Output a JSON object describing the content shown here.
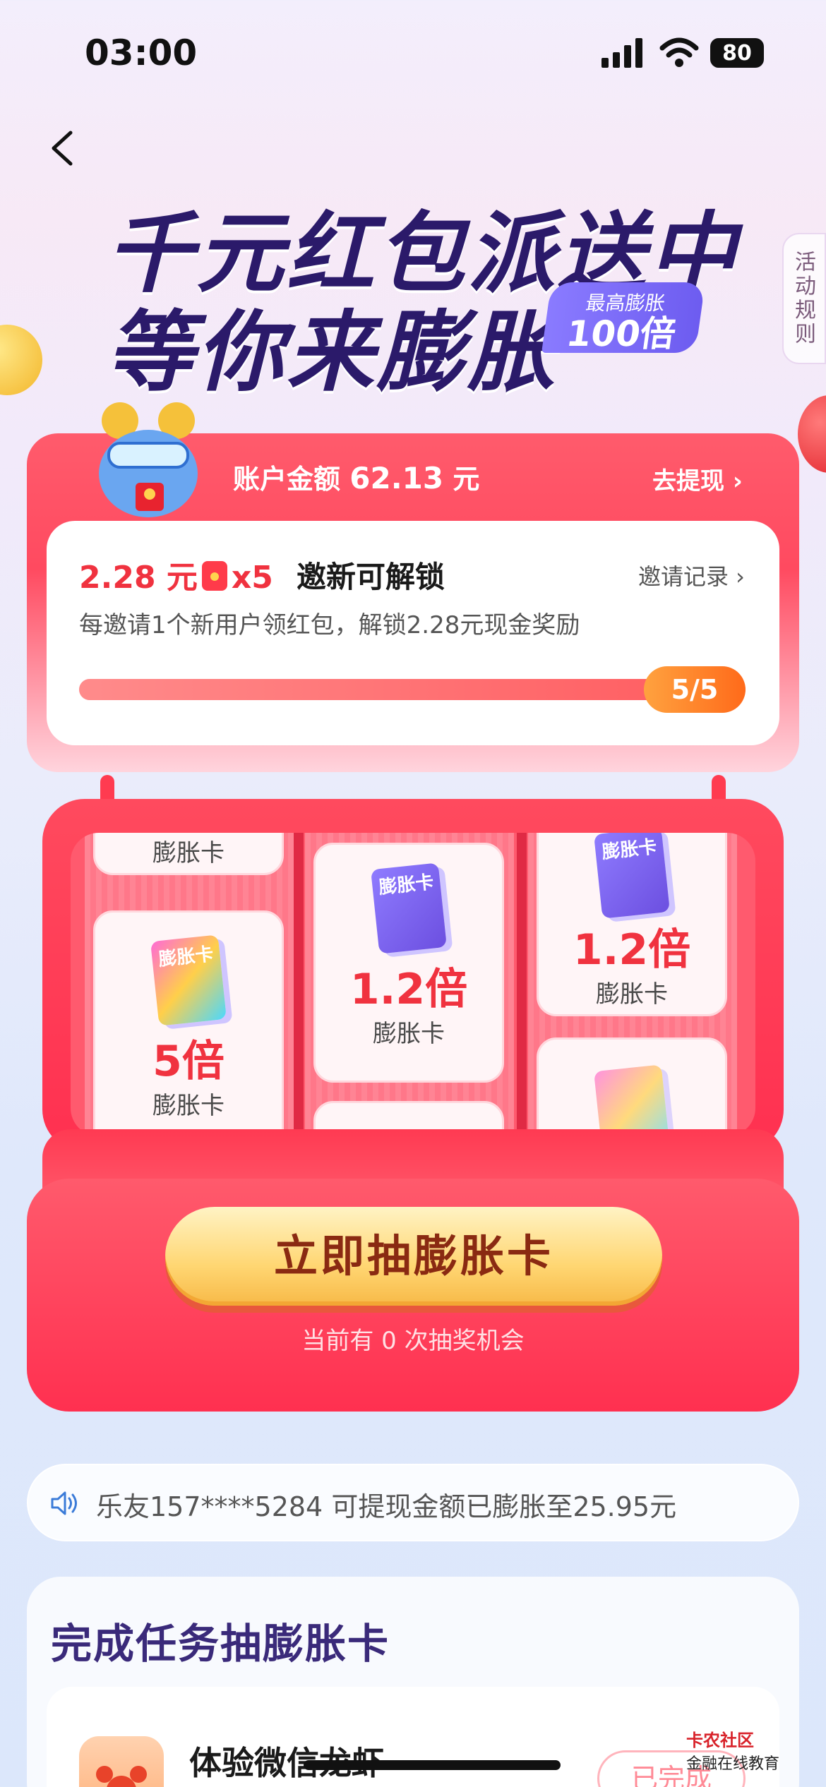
{
  "status_bar": {
    "time": "03:00",
    "battery": "80"
  },
  "header": {
    "line1": "千元红包派送中",
    "line2": "等你来膨胀",
    "badge_top": "最高膨胀",
    "badge_bottom": "100倍",
    "rules_tab": "活动规则"
  },
  "account": {
    "label": "账户金额",
    "amount": "62.13",
    "unit": "元",
    "withdraw": "去提现 ›"
  },
  "invite": {
    "amount": "2.28 元",
    "multiplier": "x5",
    "title": "邀新可解锁",
    "record_link": "邀请记录 ›",
    "description": "每邀请1个新用户领红包，解锁2.28元现金奖励",
    "progress_label": "5/5",
    "progress_fraction": 1.0
  },
  "machine": {
    "cards": [
      {
        "name": "膨胀卡",
        "mult": ""
      },
      {
        "name": "膨胀卡",
        "mult": "5倍",
        "icon": "膨胀卡"
      },
      {
        "name": "膨胀卡",
        "mult": "1.2倍",
        "icon": "膨胀卡"
      },
      {
        "name": "膨胀卡",
        "mult": "1.2倍",
        "icon": "膨胀卡"
      }
    ],
    "draw_button": "立即抽膨胀卡",
    "chances": "当前有 0 次抽奖机会"
  },
  "notice": {
    "text": "乐友157****5284 可提现金额已膨胀至25.95元"
  },
  "tasks": {
    "title": "完成任务抽膨胀卡",
    "items": [
      {
        "title": "体验微信龙虾",
        "status": "已完成"
      }
    ]
  },
  "watermark": {
    "brand": "卡农社区",
    "sub": "金融在线教育"
  },
  "colors": {
    "accent_red": "#ff4a60",
    "headline_purple": "#2b1a6a",
    "button_gold": "#ffd672"
  }
}
